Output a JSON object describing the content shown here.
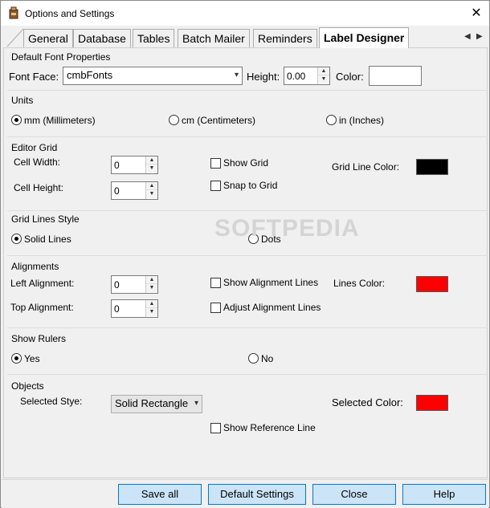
{
  "window": {
    "title": "Options and Settings",
    "close_glyph": "✕"
  },
  "tabs": [
    {
      "label": "General"
    },
    {
      "label": "Database"
    },
    {
      "label": "Tables"
    },
    {
      "label": "Batch Mailer"
    },
    {
      "label": "Reminders"
    },
    {
      "label": "Label Designer",
      "active": true
    }
  ],
  "tab_nav": {
    "left": "◀",
    "right": "▶"
  },
  "font_props": {
    "group": "Default Font Properties",
    "font_face_label": "Font Face:",
    "font_face_value": "cmbFonts",
    "height_label": "Height:",
    "height_value": "0.00",
    "color_label": "Color:"
  },
  "units": {
    "group": "Units",
    "mm": "mm (Millimeters)",
    "cm": "cm (Centimeters)",
    "in": "in (Inches)",
    "selected": "mm"
  },
  "editor_grid": {
    "group": "Editor Grid",
    "cell_width_label": "Cell Width:",
    "cell_width_value": "0",
    "cell_height_label": "Cell Height:",
    "cell_height_value": "0",
    "show_grid": "Show Grid",
    "snap_to_grid": "Snap to Grid",
    "grid_line_color_label": "Grid Line Color:",
    "grid_line_color": "#000000"
  },
  "grid_lines_style": {
    "group": "Grid Lines Style",
    "solid": "Solid Lines",
    "dots": "Dots",
    "selected": "solid"
  },
  "alignments": {
    "group": "Alignments",
    "left_label": "Left Alignment:",
    "left_value": "0",
    "top_label": "Top Alignment:",
    "top_value": "0",
    "show_lines": "Show Alignment Lines",
    "adjust_lines": "Adjust Alignment Lines",
    "lines_color_label": "Lines Color:",
    "lines_color": "#ff0000"
  },
  "show_rulers": {
    "group": "Show Rulers",
    "yes": "Yes",
    "no": "No",
    "selected": "yes"
  },
  "objects": {
    "group": "Objects",
    "selected_style_label": "Selected Stye:",
    "selected_style_value": "Solid Rectangle",
    "selected_color_label": "Selected Color:",
    "selected_color": "#ff0000",
    "show_reference": "Show Reference Line"
  },
  "footer": {
    "save_all": "Save all",
    "default_settings": "Default Settings",
    "close": "Close",
    "help": "Help"
  },
  "watermark": "SOFTPEDIA"
}
